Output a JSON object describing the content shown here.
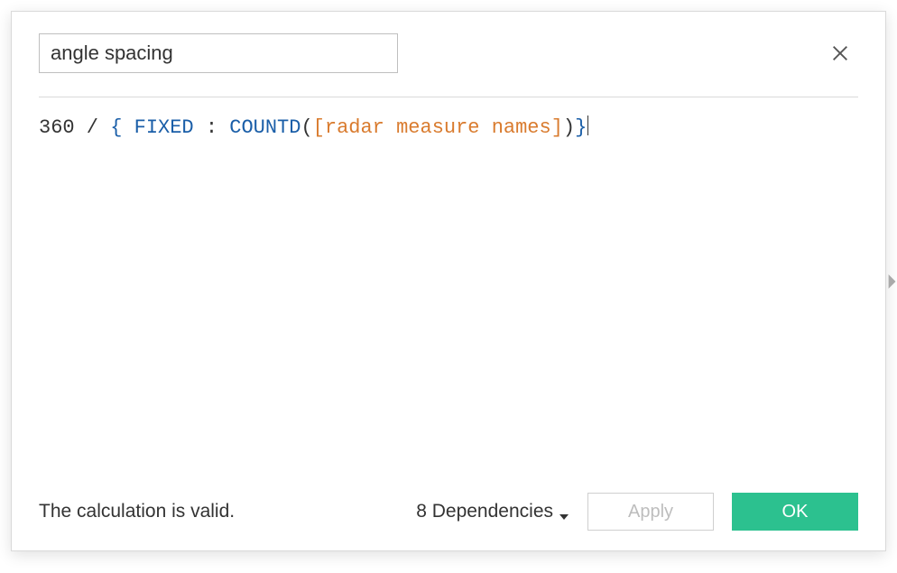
{
  "field_name": "angle spacing",
  "formula": {
    "tokens": [
      {
        "cls": "tok-plain",
        "text": "360 / "
      },
      {
        "cls": "tok-brace",
        "text": "{ "
      },
      {
        "cls": "tok-keyword",
        "text": "FIXED "
      },
      {
        "cls": "tok-plain",
        "text": ": "
      },
      {
        "cls": "tok-func",
        "text": "COUNTD"
      },
      {
        "cls": "tok-plain",
        "text": "("
      },
      {
        "cls": "tok-field",
        "text": "[radar measure names]"
      },
      {
        "cls": "tok-plain",
        "text": ")"
      },
      {
        "cls": "tok-brace",
        "text": "}"
      }
    ]
  },
  "status_text": "The calculation is valid.",
  "dependencies_label": "8 Dependencies",
  "buttons": {
    "apply": "Apply",
    "ok": "OK"
  }
}
